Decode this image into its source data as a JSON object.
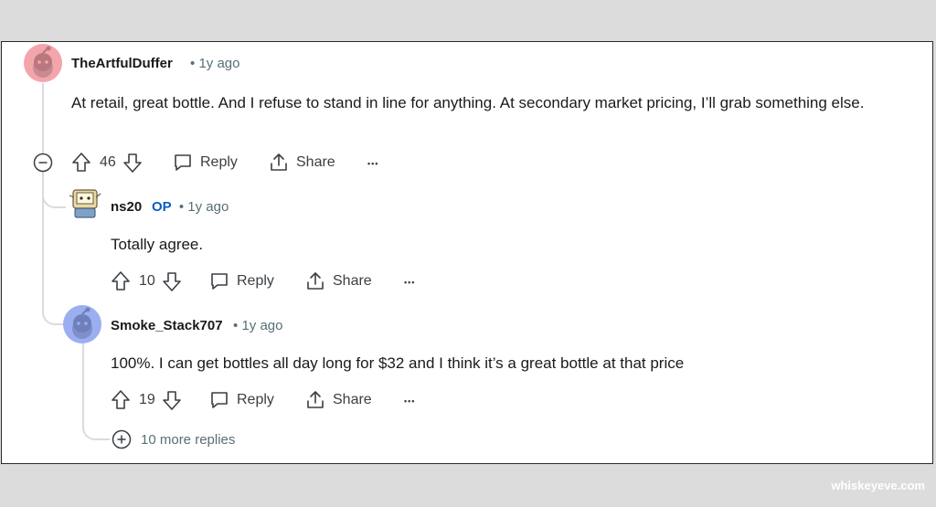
{
  "comments": [
    {
      "username": "TheArtfulDuffer",
      "op_badge": "",
      "age": "1y ago",
      "body": "At retail, great bottle. And I refuse to stand in line for anything. At secondary market pricing, I’ll grab something else.",
      "votes": "46",
      "reply_label": "Reply",
      "share_label": "Share",
      "more_label": "•••"
    },
    {
      "username": "ns20",
      "op_badge": "OP",
      "age": "1y ago",
      "body": "Totally agree.",
      "votes": "10",
      "reply_label": "Reply",
      "share_label": "Share",
      "more_label": "•••"
    },
    {
      "username": "Smoke_Stack707",
      "op_badge": "",
      "age": "1y ago",
      "body": "100%. I can get bottles all day long for $32 and I think it’s a great bottle at that price",
      "votes": "19",
      "reply_label": "Reply",
      "share_label": "Share",
      "more_label": "•••"
    }
  ],
  "more_replies": "10 more replies",
  "separator": "•",
  "watermark": "whiskeyeve.com",
  "colors": {
    "avatar_pink": "#f4a5ab",
    "avatar_blue": "#9aaef0",
    "op_blue": "#0a5ec2",
    "meta_gray": "#576f76"
  }
}
